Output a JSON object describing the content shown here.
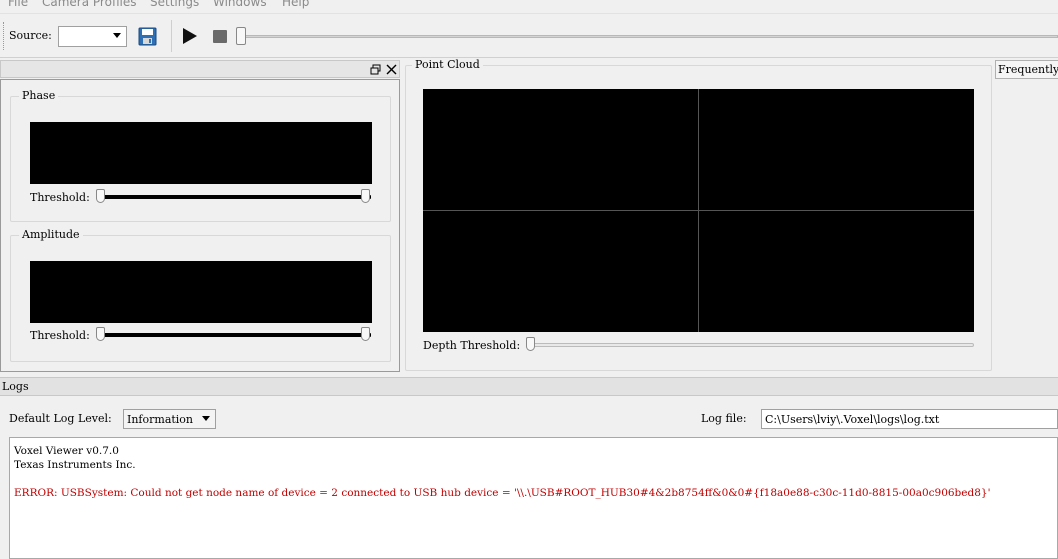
{
  "menu": [
    "File",
    "Camera Profiles",
    "Settings",
    "Windows",
    "Help"
  ],
  "toolbar": {
    "source_label": "Source:",
    "source_value": "",
    "save_icon": "floppy-disk-icon",
    "play_icon": "play-icon",
    "stop_icon": "stop-icon"
  },
  "left_panel": {
    "float_icon": "restore-window-icon",
    "close_icon": "close-icon",
    "phase": {
      "title": "Phase",
      "threshold_label": "Threshold:"
    },
    "amplitude": {
      "title": "Amplitude",
      "threshold_label": "Threshold:"
    }
  },
  "point_cloud": {
    "title": "Point Cloud",
    "depth_threshold_label": "Depth Threshold:"
  },
  "right_tab": {
    "label": "Frequently"
  },
  "logs": {
    "header": "Logs",
    "level_label": "Default Log Level:",
    "level_value": "Information",
    "file_label": "Log file:",
    "file_value": "C:\\Users\\lviy\\.Voxel\\logs\\log.txt",
    "lines": [
      {
        "text": "Voxel Viewer v0.7.0",
        "type": "info"
      },
      {
        "text": "Texas Instruments Inc.",
        "type": "info"
      },
      {
        "text": "",
        "type": "blank"
      },
      {
        "text": "ERROR: USBSystem: Could not get node name of device = 2 connected to USB hub device = '\\\\.\\USB#ROOT_HUB30#4&2b8754ff&0&0#{f18a0e88-c30c-11d0-8815-00a0c906bed8}'",
        "type": "error"
      }
    ]
  },
  "colors": {
    "error": "#c00000",
    "display_bg": "#000000",
    "grid_line": "#555555"
  }
}
